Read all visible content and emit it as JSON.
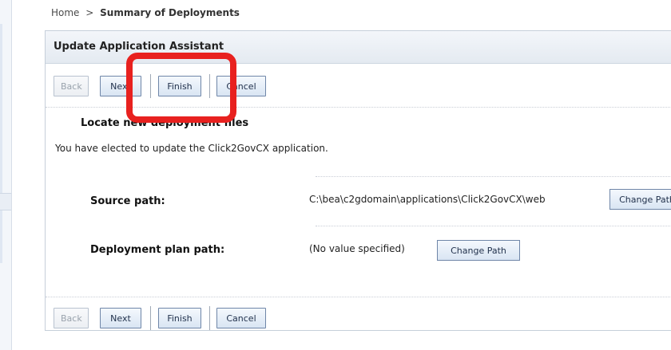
{
  "breadcrumb": {
    "home": "Home",
    "separator": ">",
    "current": "Summary of Deployments"
  },
  "panel": {
    "title": "Update Application Assistant"
  },
  "buttons": {
    "back": "Back",
    "next": "Next",
    "finish": "Finish",
    "cancel": "Cancel"
  },
  "section": {
    "title": "Locate new deployment files",
    "description": "You have elected to update the Click2GovCX application."
  },
  "source": {
    "label": "Source path:",
    "value": "C:\\bea\\c2gdomain\\applications\\Click2GovCX\\web",
    "button": "Change Path"
  },
  "plan": {
    "label": "Deployment plan path:",
    "value": "(No value specified)",
    "button": "Change Path"
  },
  "colors": {
    "highlight": "#e8211f",
    "button_border": "#6f86a8"
  }
}
